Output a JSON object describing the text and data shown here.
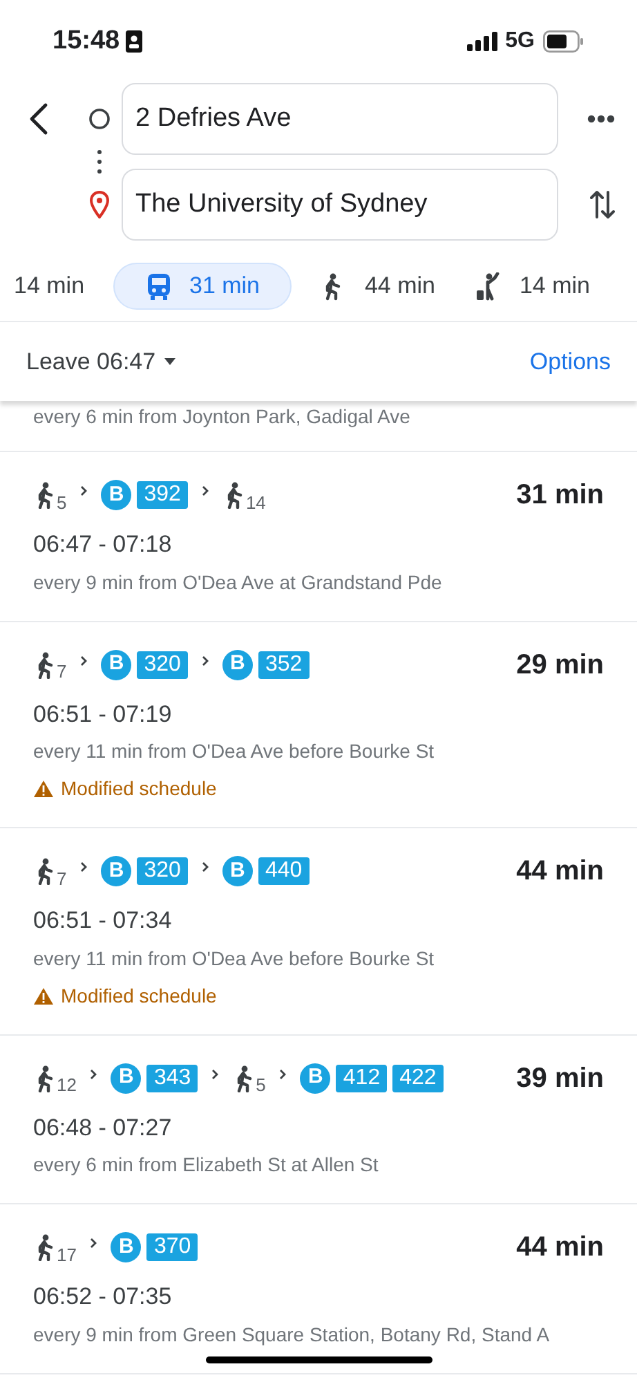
{
  "status_bar": {
    "time": "15:48",
    "network": "5G"
  },
  "search": {
    "origin": "2 Defries Ave",
    "destination": "The University of Sydney"
  },
  "modes": [
    {
      "kind": "drive",
      "label": "14 min",
      "selected": false
    },
    {
      "kind": "transit",
      "label": "31 min",
      "selected": true
    },
    {
      "kind": "walk",
      "label": "44 min",
      "selected": false
    },
    {
      "kind": "ride",
      "label": "14 min",
      "selected": false
    }
  ],
  "departure": {
    "label": "Leave 06:47",
    "options": "Options"
  },
  "partial_note": "every 6 min from Joynton Park, Gadigal Ave",
  "routes": [
    {
      "steps": [
        {
          "kind": "walk",
          "minutes": "5"
        },
        {
          "kind": "bus",
          "mark": "B",
          "lines": [
            "392"
          ]
        },
        {
          "kind": "walk",
          "minutes": "14"
        }
      ],
      "duration": "31 min",
      "times": "06:47 - 07:18",
      "note": "every 9 min from O'Dea Ave at Grandstand Pde"
    },
    {
      "steps": [
        {
          "kind": "walk",
          "minutes": "7"
        },
        {
          "kind": "bus",
          "mark": "B",
          "lines": [
            "320"
          ]
        },
        {
          "kind": "bus",
          "mark": "B",
          "lines": [
            "352"
          ]
        }
      ],
      "duration": "29 min",
      "times": "06:51 - 07:19",
      "note": "every 11 min from O'Dea Ave before Bourke St",
      "warning": "Modified schedule"
    },
    {
      "steps": [
        {
          "kind": "walk",
          "minutes": "7"
        },
        {
          "kind": "bus",
          "mark": "B",
          "lines": [
            "320"
          ]
        },
        {
          "kind": "bus",
          "mark": "B",
          "lines": [
            "440"
          ]
        }
      ],
      "duration": "44 min",
      "times": "06:51 - 07:34",
      "note": "every 11 min from O'Dea Ave before Bourke St",
      "warning": "Modified schedule"
    },
    {
      "steps": [
        {
          "kind": "walk",
          "minutes": "12"
        },
        {
          "kind": "bus",
          "mark": "B",
          "lines": [
            "343"
          ]
        },
        {
          "kind": "walk",
          "minutes": "5"
        },
        {
          "kind": "bus",
          "mark": "B",
          "lines": [
            "412",
            "422"
          ]
        }
      ],
      "duration": "39 min",
      "times": "06:48 - 07:27",
      "note": "every 6 min from Elizabeth St at Allen St"
    },
    {
      "steps": [
        {
          "kind": "walk",
          "minutes": "17"
        },
        {
          "kind": "bus",
          "mark": "B",
          "lines": [
            "370"
          ]
        }
      ],
      "duration": "44 min",
      "times": "06:52 - 07:35",
      "note": "every 9 min from Green Square Station, Botany Rd, Stand A"
    }
  ]
}
